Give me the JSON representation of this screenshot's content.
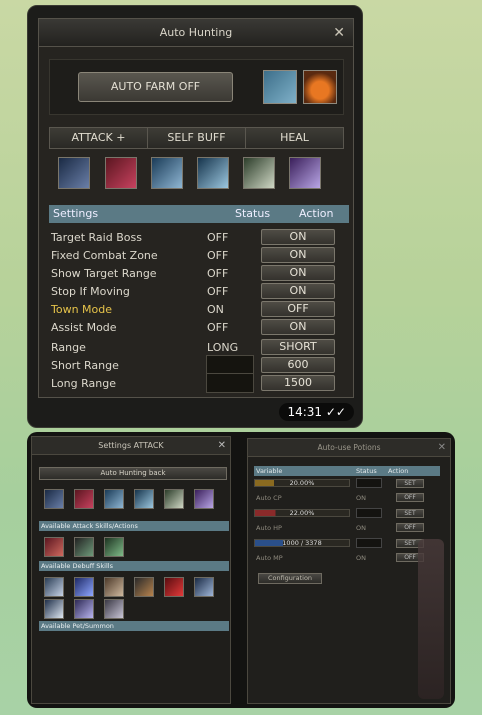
{
  "auto_hunting": {
    "title": "Auto Hunting",
    "auto_farm_label": "AUTO FARM OFF",
    "tabs": [
      "ATTACK +",
      "SELF BUFF",
      "HEAL"
    ],
    "headers": {
      "settings": "Settings",
      "status": "Status",
      "action": "Action"
    },
    "rows": [
      {
        "label": "Target Raid Boss",
        "status": "OFF",
        "action": "ON"
      },
      {
        "label": "Fixed Combat Zone",
        "status": "OFF",
        "action": "ON"
      },
      {
        "label": "Show Target Range",
        "status": "OFF",
        "action": "ON"
      },
      {
        "label": "Stop If Moving",
        "status": "OFF",
        "action": "ON"
      },
      {
        "label": "Town Mode",
        "status": "ON",
        "action": "OFF"
      },
      {
        "label": "Assist Mode",
        "status": "OFF",
        "action": "ON"
      },
      {
        "label": "Range",
        "status": "LONG",
        "action": "SHORT"
      },
      {
        "label": "Short Range",
        "status": "",
        "action": "600"
      },
      {
        "label": "Long Range",
        "status": "",
        "action": "1500"
      }
    ],
    "time": "14:31"
  },
  "settings_attack": {
    "title": "Settings ATTACK",
    "back_label": "Auto Hunting back",
    "sections": [
      "Available Attack Skills/Actions",
      "Available Debuff Skills",
      "Available Pet/Summon"
    ]
  },
  "potions": {
    "title": "Auto-use Potions",
    "headers": {
      "variable": "Variable",
      "status": "Status",
      "action": "Action"
    },
    "rows": [
      {
        "label": "Auto CP",
        "status": "ON",
        "action": "OFF",
        "bar": "20.00%",
        "set": "SET"
      },
      {
        "label": "Auto HP",
        "status": "ON",
        "action": "OFF",
        "bar": "22.00%",
        "set": "SET"
      },
      {
        "label": "Auto MP",
        "status": "ON",
        "action": "OFF",
        "bar": "1000 / 3378",
        "set": "SET"
      }
    ],
    "configuration": "Configuration"
  },
  "colors": {
    "header_bar": "#5b7a85",
    "highlight_yellow": "#e6c34a"
  }
}
